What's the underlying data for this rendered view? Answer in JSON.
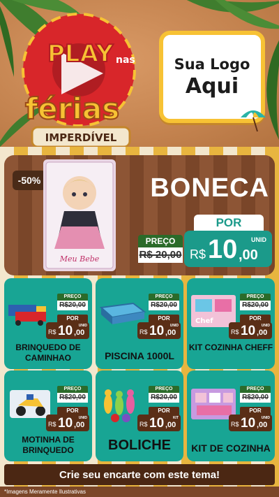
{
  "header": {
    "campaign": {
      "line1": "PLAY",
      "small": "nas",
      "line2": "férias",
      "badge": "IMPERDÍVEL"
    },
    "logo_placeholder": {
      "line1": "Sua Logo",
      "line2": "Aqui"
    }
  },
  "hero": {
    "discount": "-50%",
    "title": "BONECA",
    "packaging_label": "Meu Bebe",
    "old_label": "PREÇO",
    "old_price": "R$ 20,00",
    "new_label": "POR",
    "currency": "R$",
    "price_int": "10",
    "price_dec": ",00",
    "unit": "UNID"
  },
  "products": [
    {
      "name": "BRINQUEDO DE CAMINHAO",
      "old_label": "PREÇO",
      "old_price": "R$20,00",
      "new_label": "POR",
      "currency": "R$",
      "price_int": "10",
      "price_dec": ",00",
      "unit": "UNID"
    },
    {
      "name": "PISCINA 1000L",
      "old_label": "PREÇO",
      "old_price": "R$20,00",
      "new_label": "POR",
      "currency": "R$",
      "price_int": "10",
      "price_dec": ",00",
      "unit": "UNID"
    },
    {
      "name": "KIT COZINHA CHEFF",
      "old_label": "PREÇO",
      "old_price": "R$20,00",
      "new_label": "POR",
      "currency": "R$",
      "price_int": "10",
      "price_dec": ",00",
      "unit": "UNID",
      "packaging_label": "Chef"
    },
    {
      "name": "MOTINHA DE BRINQUEDO",
      "old_label": "PREÇO",
      "old_price": "R$20,00",
      "new_label": "POR",
      "currency": "R$",
      "price_int": "10",
      "price_dec": ",00",
      "unit": "UNID"
    },
    {
      "name": "BOLICHE",
      "old_label": "PREÇO",
      "old_price": "R$20,00",
      "new_label": "POR",
      "currency": "R$",
      "price_int": "10",
      "price_dec": ",00",
      "unit": "KIT"
    },
    {
      "name": "KIT DE COZINHA",
      "old_label": "PREÇO",
      "old_price": "R$20,00",
      "new_label": "POR",
      "currency": "R$",
      "price_int": "10",
      "price_dec": ",00",
      "unit": "UNID"
    }
  ],
  "footer": {
    "cta": "Crie seu encarte com este tema!",
    "disclaimer": "*Imagens Meramente Ilustrativas"
  },
  "colors": {
    "teal": "#18a594",
    "brown": "#5a2e16",
    "yellow": "#f7c234",
    "red": "#d8262a"
  }
}
